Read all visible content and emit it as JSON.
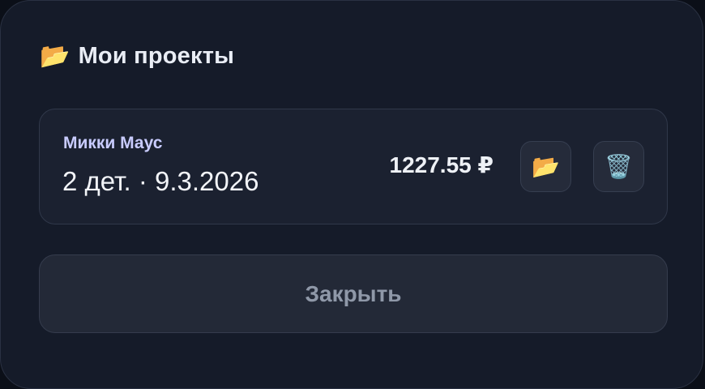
{
  "modal": {
    "title_icon": "📂",
    "title": "Мои проекты",
    "close_label": "Закрыть"
  },
  "projects": [
    {
      "name": "Микки Маус",
      "meta": "2 дет. · 9.3.2026",
      "price": "1227.55 ₽",
      "open_icon": "📂",
      "delete_icon": "🗑️"
    }
  ],
  "colors": {
    "background": "#151b29",
    "card": "#1b2130",
    "accent_name": "#c9ccff",
    "muted_button_text": "#8f98a8"
  }
}
